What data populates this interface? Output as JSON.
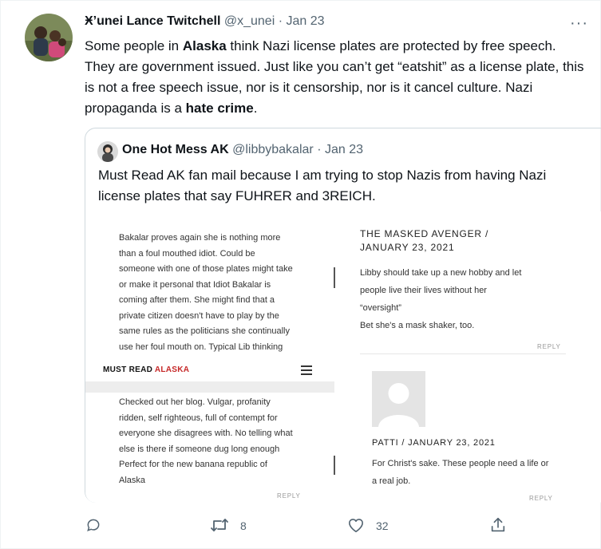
{
  "tweet": {
    "author_name": "Ӿ’unei Lance Twitchell",
    "handle": "@x_unei",
    "dot": "·",
    "date": "Jan 23",
    "text_parts": [
      "Some people in ",
      "Alaska",
      " think Nazi license plates are protected by free speech. They are government issued. Just like you can’t get “eatshit” as a license plate, this is not a free speech issue, nor is it censorship, nor is it cancel culture. Nazi propaganda is a ",
      "hate crime",
      "."
    ],
    "more_label": "···"
  },
  "quote": {
    "author_name": "One Hot Mess AK",
    "handle": "@libbybakalar",
    "dot": "·",
    "date": "Jan 23",
    "text": "Must Read AK fan mail because I am trying to stop Nazis from having Nazi license plates that say FUHRER and 3REICH."
  },
  "image": {
    "comment1_lines": [
      "Bakalar proves again she is nothing more",
      "than a foul mouthed idiot. Could be",
      "someone with one of those plates might take",
      "or make it personal that Idiot Bakalar is",
      "coming after them. She might find that a",
      "private citizen doesn't have to play by the",
      "same rules as the politicians she continually",
      "use her foul mouth on. Typical Lib thinking"
    ],
    "site_name_1": "MUST READ ",
    "site_name_2": "ALASKA",
    "comment2_lines": [
      "Checked out her blog. Vulgar, profanity",
      "ridden, self righteous, full of contempt for",
      "everyone she disagrees with. No telling what",
      "else is there if someone dug long enough",
      "Perfect for the new banana republic of",
      "Alaska"
    ],
    "reply_label": "REPLY",
    "avenger_name_1": "THE MASKED AVENGER /",
    "avenger_name_2": "JANUARY 23, 2021",
    "avenger_lines": [
      "Libby should take up a new hobby and let",
      "people live their lives without her",
      "“oversight”",
      "Bet she's a mask shaker, too."
    ],
    "patti_name": "PATTI / JANUARY 23, 2021",
    "patti_lines": [
      "For Christ's sake. These people need a life or",
      "a real job."
    ]
  },
  "actions": {
    "reply_icon": "comment-icon",
    "retweet_icon": "retweet-icon",
    "retweet_count": "8",
    "like_icon": "heart-icon",
    "like_count": "32",
    "share_icon": "share-icon"
  },
  "colors": {
    "muted": "#536471",
    "border": "#cfd9de",
    "accent_red": "#c62828"
  }
}
